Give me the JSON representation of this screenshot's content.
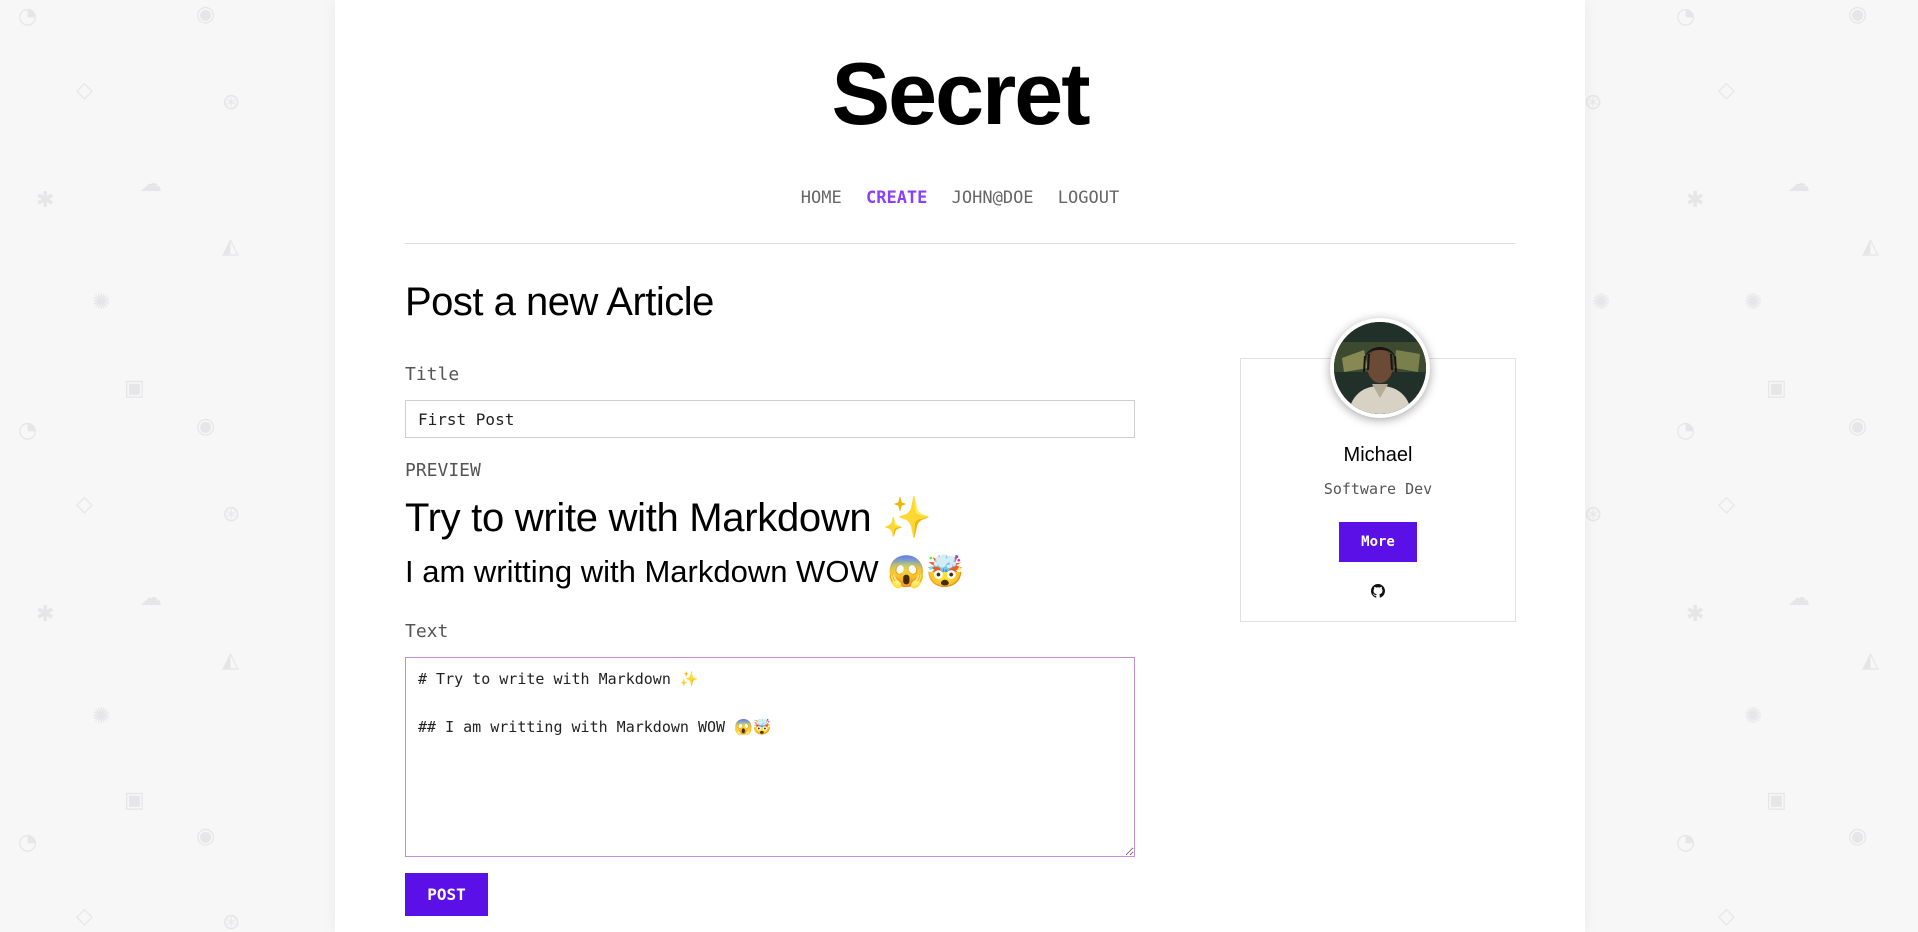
{
  "site": {
    "title": "Secret"
  },
  "nav": {
    "items": [
      {
        "label": "HOME",
        "active": false
      },
      {
        "label": "CREATE",
        "active": true
      },
      {
        "label": "JOHN@DOE",
        "active": false
      },
      {
        "label": "LOGOUT",
        "active": false
      }
    ],
    "active_color": "#8a3ffc"
  },
  "form": {
    "heading": "Post a new Article",
    "title_label": "Title",
    "title_value": "First Post",
    "preview_label": "PREVIEW",
    "preview": {
      "h1": "Try to write with Markdown ✨",
      "h2": "I am writting with Markdown WOW 😱🤯"
    },
    "text_label": "Text",
    "text_value": "# Try to write with Markdown ✨\n\n## I am writting with Markdown WOW 😱🤯",
    "submit_label": "POST"
  },
  "profile": {
    "name": "Michael",
    "role": "Software Dev",
    "more_label": "More",
    "social_icon": "github-icon"
  },
  "colors": {
    "accent": "#5b10e8",
    "background": "#f7f7f8"
  }
}
